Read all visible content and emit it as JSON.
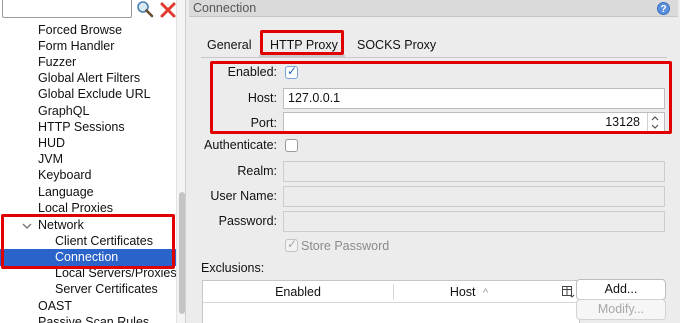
{
  "toolbar": {
    "search_value": "",
    "search_icon": "magnifier-icon",
    "clear_icon": "red-x-icon"
  },
  "tree": {
    "items": [
      "Forced Browse",
      "Form Handler",
      "Fuzzer",
      "Global Alert Filters",
      "Global Exclude URL",
      "GraphQL",
      "HTTP Sessions",
      "HUD",
      "JVM",
      "Keyboard",
      "Language",
      "Local Proxies",
      "Network",
      "Client Certificates",
      "Connection",
      "Local Servers/Proxies",
      "Server Certificates",
      "OAST",
      "Passive Scan Rules"
    ],
    "selected": "Connection",
    "selection_color": "#2a63c9"
  },
  "panel": {
    "title": "Connection",
    "help_icon": "?"
  },
  "tabs": [
    "General",
    "HTTP Proxy",
    "SOCKS Proxy"
  ],
  "active_tab": "HTTP Proxy",
  "form": {
    "enabled_label": "Enabled:",
    "enabled_checked": true,
    "host_label": "Host:",
    "host_value": "127.0.0.1",
    "port_label": "Port:",
    "port_value": "13128",
    "authenticate_label": "Authenticate:",
    "authenticate_checked": false,
    "realm_label": "Realm:",
    "realm_value": "",
    "username_label": "User Name:",
    "username_value": "",
    "password_label": "Password:",
    "password_value": "",
    "store_password_label": "Store Password",
    "store_password_checked": true,
    "exclusions_label": "Exclusions:"
  },
  "exclusions_table": {
    "columns": [
      "Enabled",
      "Host"
    ],
    "host_sort_icon": "^",
    "column_chooser_icon": "column-chooser-icon"
  },
  "buttons": {
    "add": "Add...",
    "modify": "Modify..."
  },
  "highlight_color": "#e00000"
}
